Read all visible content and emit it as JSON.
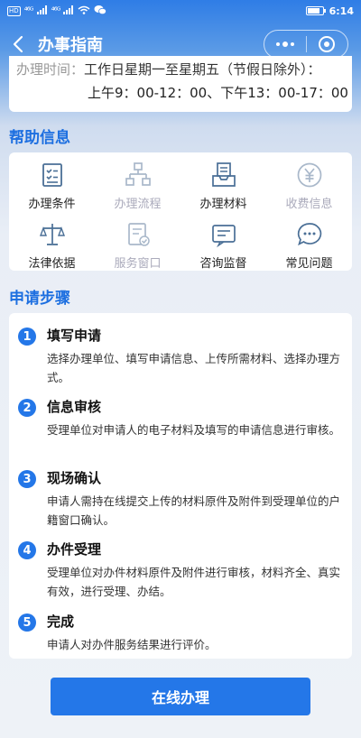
{
  "status_bar": {
    "network_left": "HD",
    "signal1": "⁴⁶ᴳ",
    "signal2": "⁴⁶ᴳ",
    "time": "6:14"
  },
  "nav": {
    "title": "办事指南"
  },
  "time_card": {
    "label": "办理时间：",
    "line1": "工作日星期一至星期五（节假日除外）：",
    "line2": "上午9：00-12：00、下午13：00-17：00"
  },
  "help": {
    "title": "帮助信息",
    "items": [
      {
        "label": "办理条件",
        "icon": "checklist-icon",
        "enabled": true
      },
      {
        "label": "办理流程",
        "icon": "flowchart-icon",
        "enabled": false
      },
      {
        "label": "办理材料",
        "icon": "inbox-icon",
        "enabled": true
      },
      {
        "label": "收费信息",
        "icon": "yen-icon",
        "enabled": false
      },
      {
        "label": "法律依据",
        "icon": "scales-icon",
        "enabled": true
      },
      {
        "label": "服务窗口",
        "icon": "form-check-icon",
        "enabled": false
      },
      {
        "label": "咨询监督",
        "icon": "message-box-icon",
        "enabled": true
      },
      {
        "label": "常见问题",
        "icon": "chat-bubble-icon",
        "enabled": true
      }
    ]
  },
  "steps": {
    "title": "申请步骤",
    "items": [
      {
        "num": "1",
        "title": "填写申请",
        "desc": "选择办理单位、填写申请信息、上传所需材料、选择办理方式。"
      },
      {
        "num": "2",
        "title": "信息审核",
        "desc": "受理单位对申请人的电子材料及填写的申请信息进行审核。"
      },
      {
        "num": "3",
        "title": "现场确认",
        "desc": "申请人需持在线提交上传的材料原件及附件到受理单位的户籍窗口确认。"
      },
      {
        "num": "4",
        "title": "办件受理",
        "desc": "受理单位对办件材料原件及附件进行审核，材料齐全、真实有效，进行受理、办结。"
      },
      {
        "num": "5",
        "title": "完成",
        "desc": "申请人对办件服务结果进行评价。"
      }
    ]
  },
  "actions": {
    "online_label": "在线办理"
  },
  "colors": {
    "accent": "#2477e8",
    "section_title": "#1d6fe0",
    "icon_active": "#4a6f96",
    "icon_disabled": "#a9b8ca"
  }
}
